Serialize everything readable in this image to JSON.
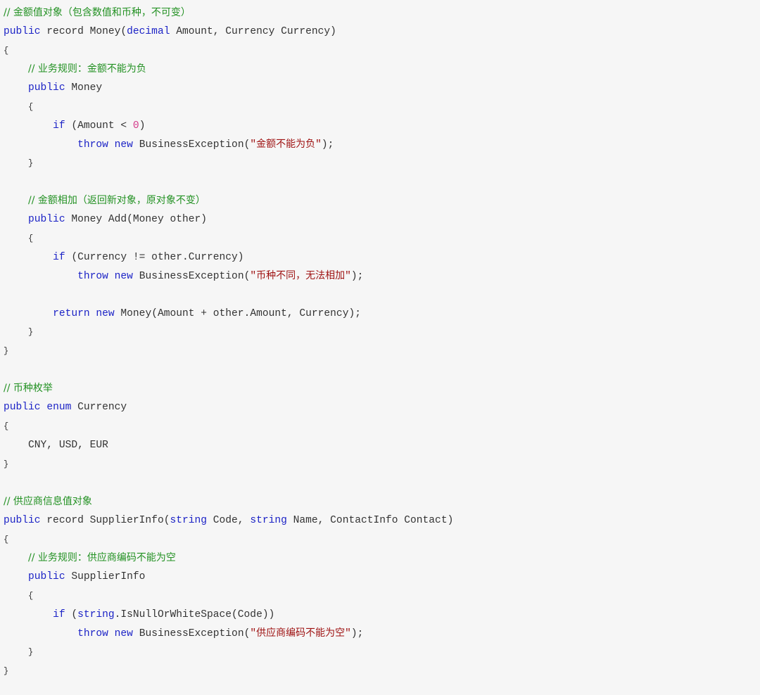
{
  "lines": [
    [
      {
        "t": "cm",
        "v": "// 金额值对象（包含数值和币种，不可变）"
      }
    ],
    [
      {
        "t": "kw",
        "v": "public"
      },
      {
        "t": "tx",
        "v": " record Money("
      },
      {
        "t": "kw",
        "v": "decimal"
      },
      {
        "t": "tx",
        "v": " Amount, Currency Currency)"
      }
    ],
    [
      {
        "t": "br",
        "v": "{"
      }
    ],
    [
      {
        "t": "tx",
        "v": "    "
      },
      {
        "t": "cm",
        "v": "// 业务规则：金额不能为负"
      }
    ],
    [
      {
        "t": "tx",
        "v": "    "
      },
      {
        "t": "kw",
        "v": "public"
      },
      {
        "t": "tx",
        "v": " Money"
      }
    ],
    [
      {
        "t": "tx",
        "v": "    "
      },
      {
        "t": "br",
        "v": "{"
      }
    ],
    [
      {
        "t": "tx",
        "v": "        "
      },
      {
        "t": "kw",
        "v": "if"
      },
      {
        "t": "tx",
        "v": " (Amount < "
      },
      {
        "t": "num",
        "v": "0"
      },
      {
        "t": "tx",
        "v": ")"
      }
    ],
    [
      {
        "t": "tx",
        "v": "            "
      },
      {
        "t": "kw",
        "v": "throw"
      },
      {
        "t": "tx",
        "v": " "
      },
      {
        "t": "kw",
        "v": "new"
      },
      {
        "t": "tx",
        "v": " BusinessException("
      },
      {
        "t": "str",
        "v": "\""
      },
      {
        "t": "strz",
        "v": "金额不能为负"
      },
      {
        "t": "str",
        "v": "\""
      },
      {
        "t": "tx",
        "v": ");"
      }
    ],
    [
      {
        "t": "tx",
        "v": "    "
      },
      {
        "t": "br",
        "v": "}"
      }
    ],
    [],
    [
      {
        "t": "tx",
        "v": "    "
      },
      {
        "t": "cm",
        "v": "// 金额相加（返回新对象，原对象不变）"
      }
    ],
    [
      {
        "t": "tx",
        "v": "    "
      },
      {
        "t": "kw",
        "v": "public"
      },
      {
        "t": "tx",
        "v": " Money Add(Money other)"
      }
    ],
    [
      {
        "t": "tx",
        "v": "    "
      },
      {
        "t": "br",
        "v": "{"
      }
    ],
    [
      {
        "t": "tx",
        "v": "        "
      },
      {
        "t": "kw",
        "v": "if"
      },
      {
        "t": "tx",
        "v": " (Currency != other.Currency)"
      }
    ],
    [
      {
        "t": "tx",
        "v": "            "
      },
      {
        "t": "kw",
        "v": "throw"
      },
      {
        "t": "tx",
        "v": " "
      },
      {
        "t": "kw",
        "v": "new"
      },
      {
        "t": "tx",
        "v": " BusinessException("
      },
      {
        "t": "str",
        "v": "\""
      },
      {
        "t": "strz",
        "v": "币种不同，无法相加"
      },
      {
        "t": "str",
        "v": "\""
      },
      {
        "t": "tx",
        "v": ");"
      }
    ],
    [],
    [
      {
        "t": "tx",
        "v": "        "
      },
      {
        "t": "kw",
        "v": "return"
      },
      {
        "t": "tx",
        "v": " "
      },
      {
        "t": "kw",
        "v": "new"
      },
      {
        "t": "tx",
        "v": " Money(Amount + other.Amount, Currency);"
      }
    ],
    [
      {
        "t": "tx",
        "v": "    "
      },
      {
        "t": "br",
        "v": "}"
      }
    ],
    [
      {
        "t": "br",
        "v": "}"
      }
    ],
    [],
    [
      {
        "t": "cm",
        "v": "// 币种枚举"
      }
    ],
    [
      {
        "t": "kw",
        "v": "public"
      },
      {
        "t": "tx",
        "v": " "
      },
      {
        "t": "kw",
        "v": "enum"
      },
      {
        "t": "tx",
        "v": " Currency"
      }
    ],
    [
      {
        "t": "br",
        "v": "{"
      }
    ],
    [
      {
        "t": "tx",
        "v": "    CNY, USD, EUR"
      }
    ],
    [
      {
        "t": "br",
        "v": "}"
      }
    ],
    [],
    [
      {
        "t": "cm",
        "v": "// 供应商信息值对象"
      }
    ],
    [
      {
        "t": "kw",
        "v": "public"
      },
      {
        "t": "tx",
        "v": " record SupplierInfo("
      },
      {
        "t": "kw",
        "v": "string"
      },
      {
        "t": "tx",
        "v": " Code, "
      },
      {
        "t": "kw",
        "v": "string"
      },
      {
        "t": "tx",
        "v": " Name, ContactInfo Contact)"
      }
    ],
    [
      {
        "t": "br",
        "v": "{"
      }
    ],
    [
      {
        "t": "tx",
        "v": "    "
      },
      {
        "t": "cm",
        "v": "// 业务规则：供应商编码不能为空"
      }
    ],
    [
      {
        "t": "tx",
        "v": "    "
      },
      {
        "t": "kw",
        "v": "public"
      },
      {
        "t": "tx",
        "v": " SupplierInfo"
      }
    ],
    [
      {
        "t": "tx",
        "v": "    "
      },
      {
        "t": "br",
        "v": "{"
      }
    ],
    [
      {
        "t": "tx",
        "v": "        "
      },
      {
        "t": "kw",
        "v": "if"
      },
      {
        "t": "tx",
        "v": " ("
      },
      {
        "t": "kw",
        "v": "string"
      },
      {
        "t": "tx",
        "v": ".IsNullOrWhiteSpace(Code))"
      }
    ],
    [
      {
        "t": "tx",
        "v": "            "
      },
      {
        "t": "kw",
        "v": "throw"
      },
      {
        "t": "tx",
        "v": " "
      },
      {
        "t": "kw",
        "v": "new"
      },
      {
        "t": "tx",
        "v": " BusinessException("
      },
      {
        "t": "str",
        "v": "\""
      },
      {
        "t": "strz",
        "v": "供应商编码不能为空"
      },
      {
        "t": "str",
        "v": "\""
      },
      {
        "t": "tx",
        "v": ");"
      }
    ],
    [
      {
        "t": "tx",
        "v": "    "
      },
      {
        "t": "br",
        "v": "}"
      }
    ],
    [
      {
        "t": "br",
        "v": "}"
      }
    ]
  ]
}
